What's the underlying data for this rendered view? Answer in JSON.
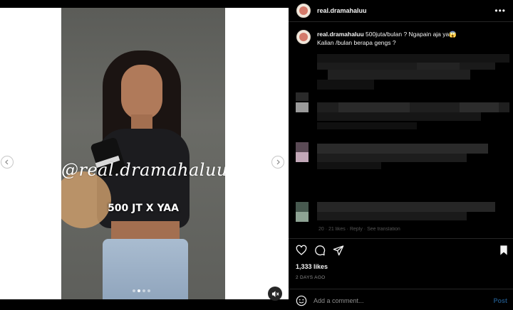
{
  "post": {
    "username": "real.dramahaluu",
    "caption_username": "real.dramahaluu",
    "caption_line1": "500juta/bulan ? Ngapain aja ya😱",
    "caption_line2": "Kalian /bulan berapa gengs ?",
    "likes": "1,333 likes",
    "time_ago": "2 DAYS AGO"
  },
  "media": {
    "watermark": "@real.dramahaluu",
    "overlay_text": "500 JT X YAA",
    "dot_count": 4,
    "active_dot": 1
  },
  "comments": {
    "meta_fragment": "20 · 21 likes · Reply · See translation"
  },
  "comment_box": {
    "placeholder": "Add a comment...",
    "post_label": "Post"
  },
  "icons": {
    "more": "more-icon",
    "nav_prev": "chevron-left-icon",
    "nav_next": "chevron-right-icon",
    "mute": "muted-speaker-icon",
    "like": "heart-icon",
    "comment": "comment-icon",
    "share": "send-icon",
    "save": "bookmark-icon",
    "emoji": "emoji-icon"
  },
  "colors": {
    "background": "#000000",
    "text": "#f5f5f5",
    "muted": "#8e8e8e",
    "post_button": "#1d4e7a"
  }
}
